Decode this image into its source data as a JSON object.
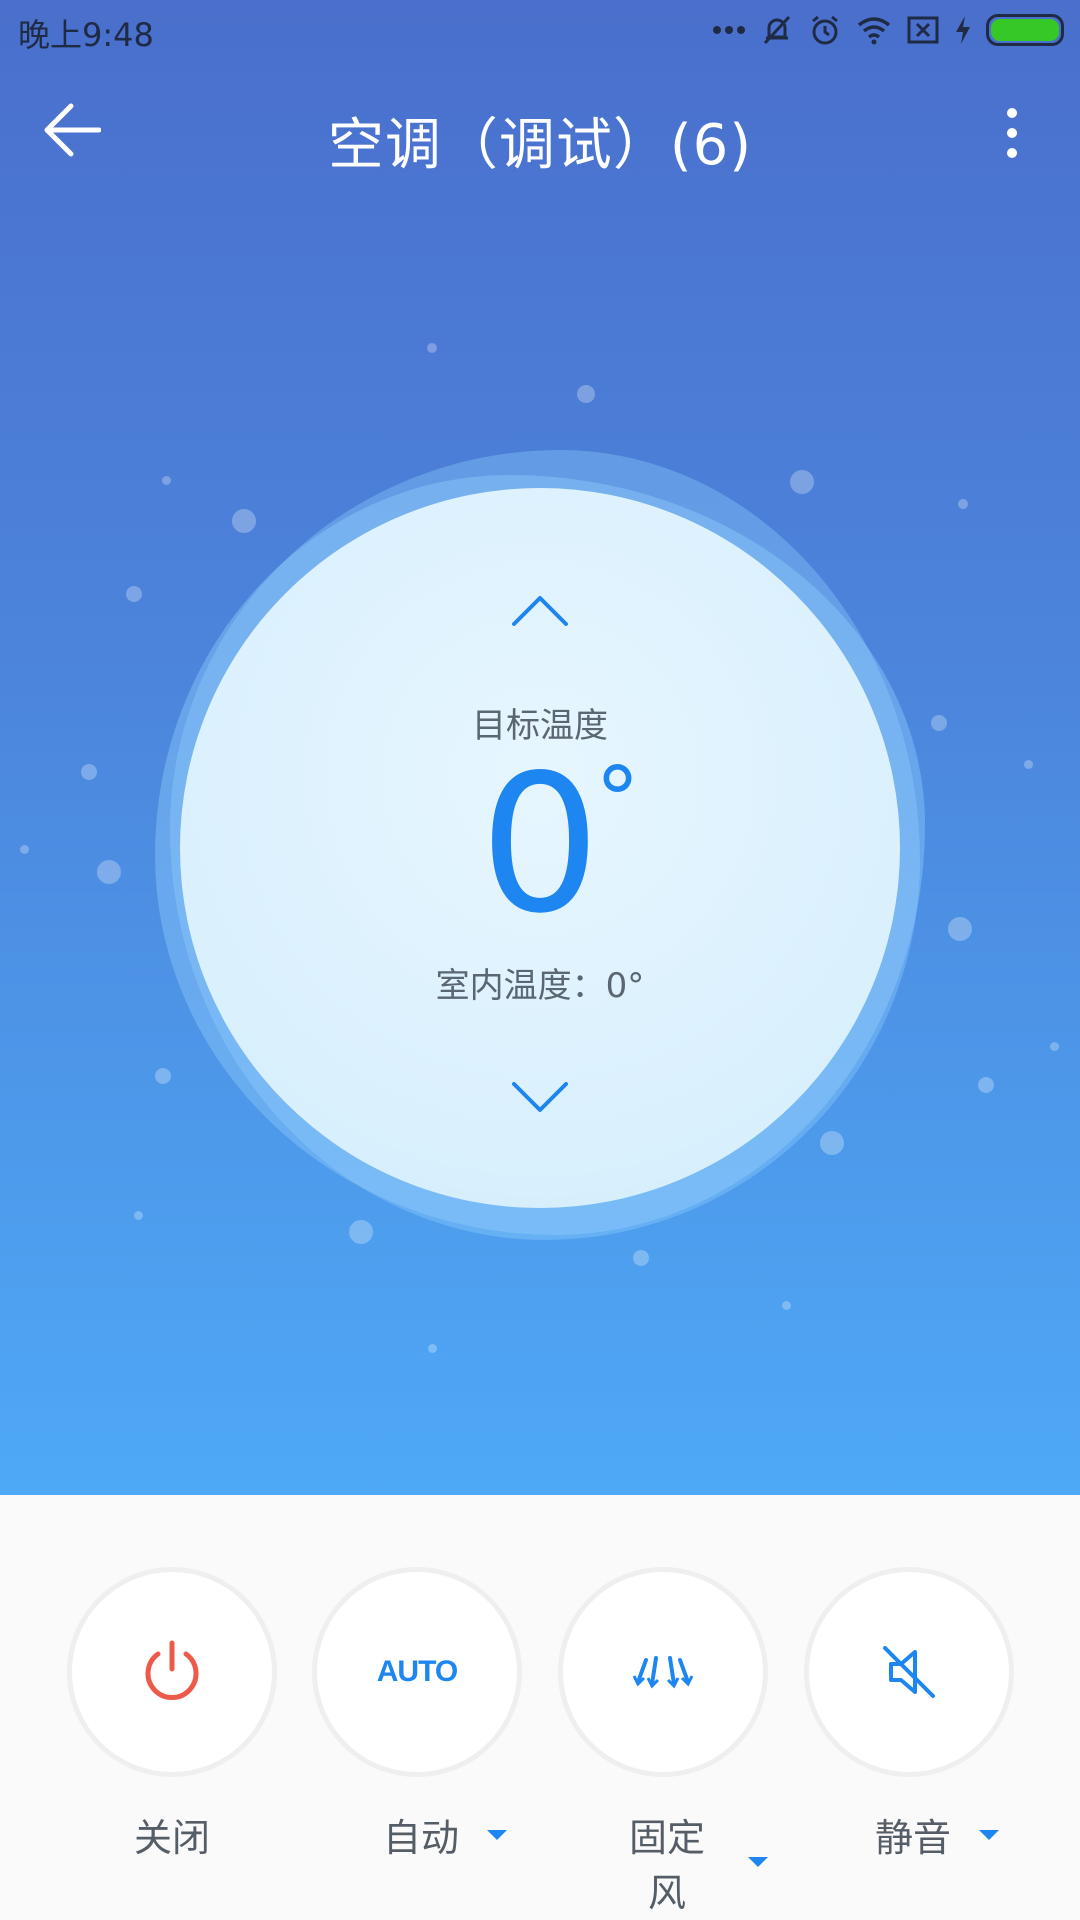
{
  "status_bar": {
    "time": "晚上9:48",
    "icons": [
      "more-dots-icon",
      "mute-notification-icon",
      "alarm-icon",
      "wifi-icon",
      "sim-disabled-icon",
      "charging-icon",
      "battery-icon"
    ],
    "battery_color": "#35c826"
  },
  "app_bar": {
    "title": "空调（调试）(6)",
    "back_icon": "back-arrow-icon",
    "more_icon": "more-vert-icon"
  },
  "dial": {
    "target_label": "目标温度",
    "target_value": "0",
    "degree_symbol": "°",
    "indoor_label": "室内温度：0°",
    "accent_color": "#1e86f0"
  },
  "controls": [
    {
      "id": "power",
      "icon": "power-icon",
      "label": "关闭",
      "icon_color": "#ee5a4a",
      "has_dropdown": false
    },
    {
      "id": "mode",
      "icon": "auto-icon",
      "icon_text": "AUTO",
      "label": "自动",
      "has_dropdown": true
    },
    {
      "id": "wind",
      "icon": "fixed-wind-icon",
      "label": "固定风",
      "has_dropdown": true
    },
    {
      "id": "mute",
      "icon": "mute-icon",
      "label": "静音",
      "has_dropdown": true
    }
  ]
}
